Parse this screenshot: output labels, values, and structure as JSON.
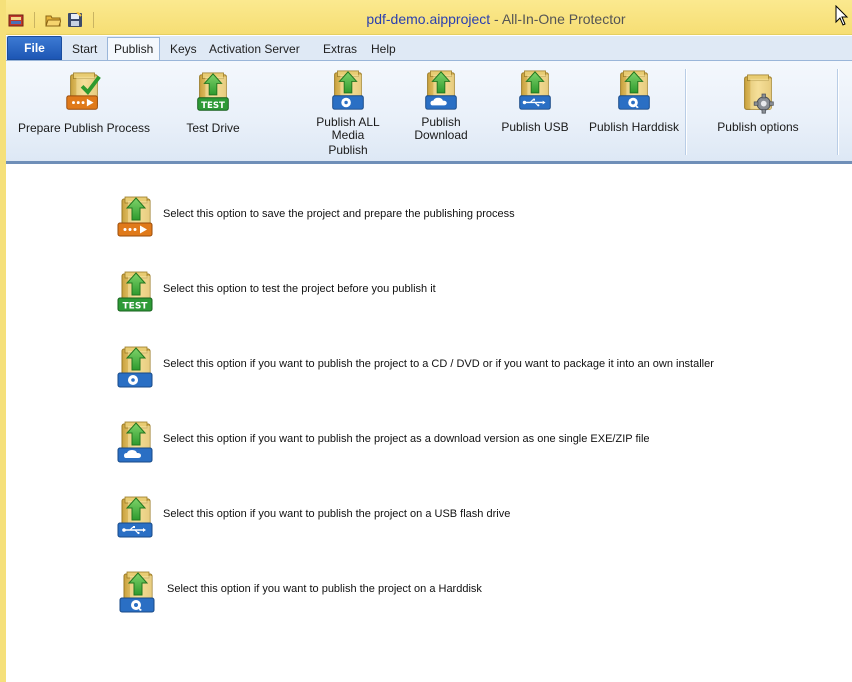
{
  "window": {
    "document_name": "pdf-demo.aipproject",
    "title_separator": " - ",
    "app_name": "All-In-One Protector"
  },
  "quick_access": {
    "items": [
      {
        "name": "app-menu-icon"
      },
      {
        "name": "open-folder-icon"
      },
      {
        "name": "save-icon"
      }
    ]
  },
  "tabs": {
    "file": "File",
    "start": "Start",
    "publish": "Publish",
    "keys": "Keys",
    "activation_server": "Activation Server",
    "extras": "Extras",
    "help": "Help",
    "active": "Publish"
  },
  "ribbon": {
    "prepare": "Prepare Publish Process",
    "test_drive": "Test Drive",
    "publish_all_1": "Publish ALL",
    "publish_all_2": "Media",
    "publish_all_3": "Publish",
    "download_1": "Publish",
    "download_2": "Download",
    "usb": "Publish USB",
    "harddisk": "Publish Harddisk",
    "options": "Publish options"
  },
  "options": [
    {
      "icon": "prepare-publish-icon",
      "text": "Select this option to save the project and prepare the publishing process"
    },
    {
      "icon": "test-drive-icon",
      "text": "Select this option to test the project before you publish it"
    },
    {
      "icon": "cd-dvd-icon",
      "text": "Select this option if you want to publish the project to a CD / DVD or if you want to package it into an own installer"
    },
    {
      "icon": "cloud-download-icon",
      "text": "Select this option if you want to publish the project as a download version as one single EXE/ZIP file"
    },
    {
      "icon": "usb-icon",
      "text": "Select this option if you want to publish the project on a USB flash drive"
    },
    {
      "icon": "harddisk-icon",
      "text": "Select this option if you want to publish the project on a Harddisk"
    }
  ],
  "colors": {
    "title_frame": "#f6de74",
    "file_tab": "#1d56b4",
    "ribbon_bg": "#e9f0f9",
    "arrow_green": "#3aa83a",
    "badge_orange": "#e07a1a",
    "badge_green": "#2d9a36",
    "badge_blue": "#2a6fc4"
  }
}
